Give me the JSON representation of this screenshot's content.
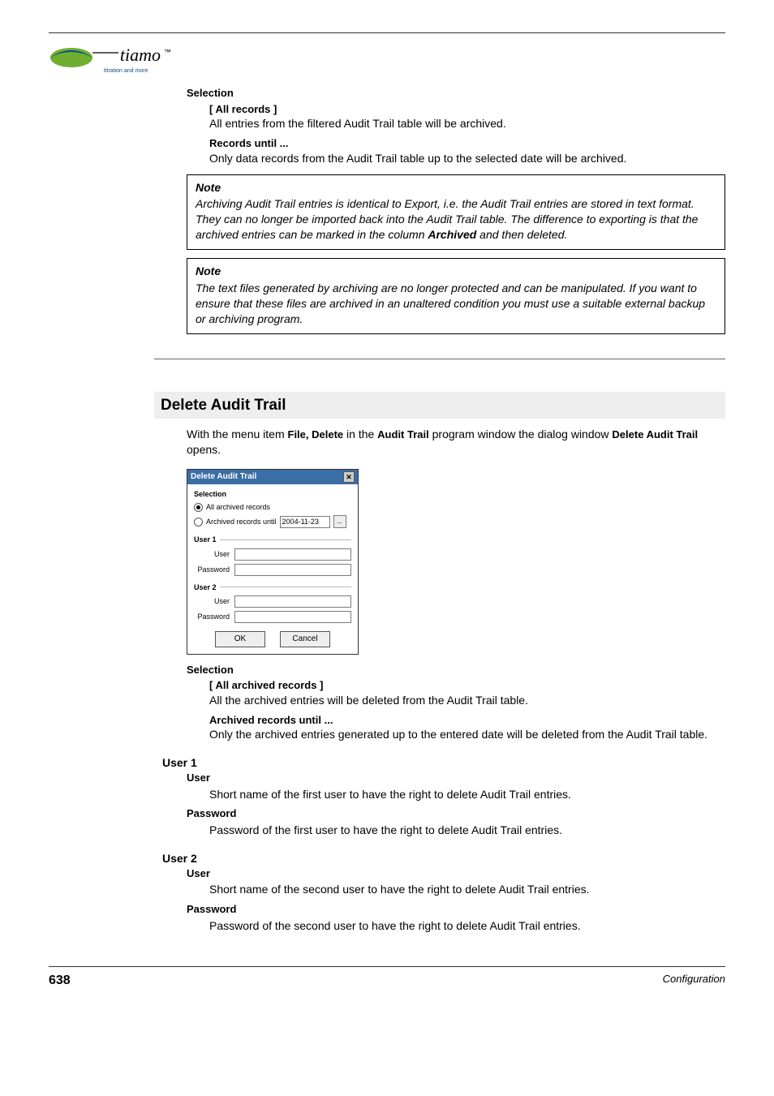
{
  "logo_brand": "tiamo",
  "logo_tm": "™",
  "logo_tag": "titration and more",
  "archive": {
    "selection_heading": "Selection",
    "all_term": "[ All records ]",
    "all_desc": "All entries from the filtered Audit Trail table will be archived.",
    "until_term": "Records until ...",
    "until_desc": "Only data records from the Audit Trail table up to the selected date will be archived."
  },
  "note1": {
    "title": "Note",
    "body_pre": "Archiving Audit Trail entries is identical to Export, i.e. the Audit Trail entries are stored in text format. They can no longer be imported back into the Audit Trail table. The difference to exporting is that the archived entries can be marked in the column ",
    "bold": "Archived",
    "body_post": " and then deleted."
  },
  "note2": {
    "title": "Note",
    "body": "The text files generated by archiving are no longer protected and can be manipulated. If you want to ensure that these files are archived in an unaltered condition you must use a suitable external backup or archiving program."
  },
  "section_title": "Delete Audit Trail",
  "intro": {
    "t1": "With the menu item ",
    "b1": "File, Delete",
    "t2": " in the ",
    "b2": "Audit Trail",
    "t3": " program window the dialog window ",
    "b3": "Delete Audit Trail",
    "t4": " opens."
  },
  "dialog": {
    "title": "Delete Audit Trail",
    "group_selection": "Selection",
    "opt_all": "All archived records",
    "opt_until": "Archived records until",
    "date_value": "2004-11-23",
    "dots": "...",
    "user1": "User 1",
    "user2": "User 2",
    "lbl_user": "User",
    "lbl_pass": "Password",
    "btn_ok": "OK",
    "btn_cancel": "Cancel"
  },
  "delete": {
    "selection_heading": "Selection",
    "all_term": "[ All archived records ]",
    "all_desc": "All the archived entries will be deleted from the Audit Trail table.",
    "until_term": "Archived records until ...",
    "until_desc": "Only the archived entries generated up to the entered date will be deleted from the Audit Trail table."
  },
  "user1": {
    "heading": "User 1",
    "u_term": "User",
    "u_desc": "Short name of the first user to have the right to delete Audit Trail entries.",
    "p_term": "Password",
    "p_desc": "Password of the first user to have the right to delete Audit Trail entries."
  },
  "user2": {
    "heading": "User 2",
    "u_term": "User",
    "u_desc": "Short name of the second user to have the right to delete Audit Trail entries.",
    "p_term": "Password",
    "p_desc": "Password of the second user to have the right to delete Audit Trail entries."
  },
  "footer": {
    "page": "638",
    "section": "Configuration"
  }
}
